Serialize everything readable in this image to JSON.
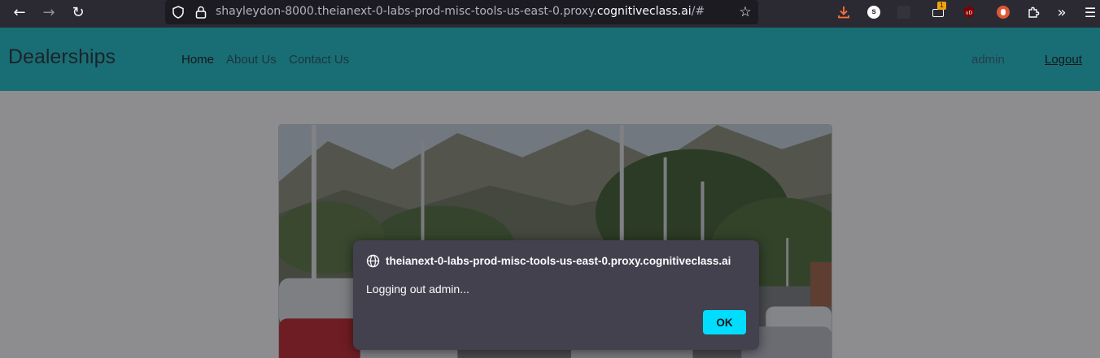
{
  "browser": {
    "url_prefix": "shayleydon-8000.theianext-0-labs-prod-misc-tools-us-east-0.proxy.",
    "url_domain": "cognitiveclass.ai",
    "url_suffix": "/#",
    "extension_badge": "1"
  },
  "navbar": {
    "brand": "Dealerships",
    "links": [
      "Home",
      "About Us",
      "Contact Us"
    ],
    "username": "admin",
    "logout": "Logout"
  },
  "dialog": {
    "origin": "theianext-0-labs-prod-misc-tools-us-east-0.proxy.cognitiveclass.ai",
    "message": "Logging out admin...",
    "ok_label": "OK"
  },
  "colors": {
    "navbar": "#17c1c9",
    "dialog_bg": "#42414d",
    "ok_button": "#00ddff"
  }
}
